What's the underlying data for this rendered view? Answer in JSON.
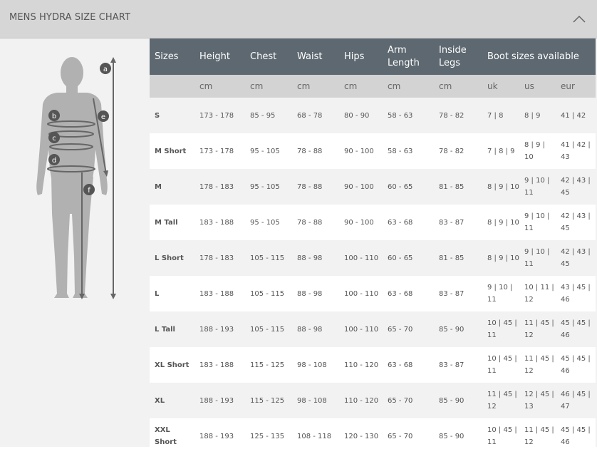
{
  "header": {
    "title": "MENS HYDRA SIZE CHART"
  },
  "figure": {
    "markers": [
      "a",
      "b",
      "c",
      "d",
      "e",
      "f"
    ]
  },
  "table": {
    "columns": [
      "Sizes",
      "Height",
      "Chest",
      "Waist",
      "Hips",
      "Arm Length",
      "Inside Legs",
      "Boot sizes available"
    ],
    "units": [
      "",
      "cm",
      "cm",
      "cm",
      "cm",
      "cm",
      "cm",
      "uk",
      "us",
      "eur"
    ],
    "rows": [
      [
        "S",
        "173 - 178",
        "85 - 95",
        "68 - 78",
        "80 - 90",
        "58 - 63",
        "78 - 82",
        "7 | 8",
        "8 | 9",
        "41 | 42"
      ],
      [
        "M Short",
        "173 - 178",
        "95 - 105",
        "78 - 88",
        "90 - 100",
        "58 - 63",
        "78 - 82",
        "7 | 8 | 9",
        "8 | 9 | 10",
        "41 | 42 | 43"
      ],
      [
        "M",
        "178 - 183",
        "95 - 105",
        "78 - 88",
        "90 - 100",
        "60 - 65",
        "81 - 85",
        "8 | 9 | 10",
        "9 | 10 | 11",
        "42 | 43 | 45"
      ],
      [
        "M Tall",
        "183 - 188",
        "95 - 105",
        "78 - 88",
        "90 - 100",
        "63 - 68",
        "83 - 87",
        "8 | 9 | 10",
        "9 | 10 | 11",
        "42 | 43 | 45"
      ],
      [
        "L Short",
        "178 - 183",
        "105 - 115",
        "88 - 98",
        "100 - 110",
        "60 - 65",
        "81 - 85",
        "8 | 9 | 10",
        "9 | 10 | 11",
        "42 | 43 | 45"
      ],
      [
        "L",
        "183 - 188",
        "105 - 115",
        "88 - 98",
        "100 - 110",
        "63 - 68",
        "83 - 87",
        "9 | 10 | 11",
        "10 | 11 | 12",
        "43 | 45 | 46"
      ],
      [
        "L Tall",
        "188 - 193",
        "105 - 115",
        "88 - 98",
        "100 - 110",
        "65 - 70",
        "85 - 90",
        "10 | 45 | 11",
        "11 | 45 | 12",
        "45 | 45 | 46"
      ],
      [
        "XL Short",
        "183 - 188",
        "115 - 125",
        "98 - 108",
        "110 - 120",
        "63 - 68",
        "83 - 87",
        "10 | 45 | 11",
        "11 | 45 | 12",
        "45 | 45 | 46"
      ],
      [
        "XL",
        "188 - 193",
        "115 - 125",
        "98 - 108",
        "110 - 120",
        "65 - 70",
        "85 - 90",
        "11 | 45 | 12",
        "12 | 45 | 13",
        "46 | 45 | 47"
      ],
      [
        "XXL Short",
        "188 - 193",
        "125 - 135",
        "108 - 118",
        "120 - 130",
        "65 - 70",
        "85 - 90",
        "10 | 45 | 11",
        "11 | 45 | 12",
        "45 | 45 | 46"
      ]
    ]
  }
}
